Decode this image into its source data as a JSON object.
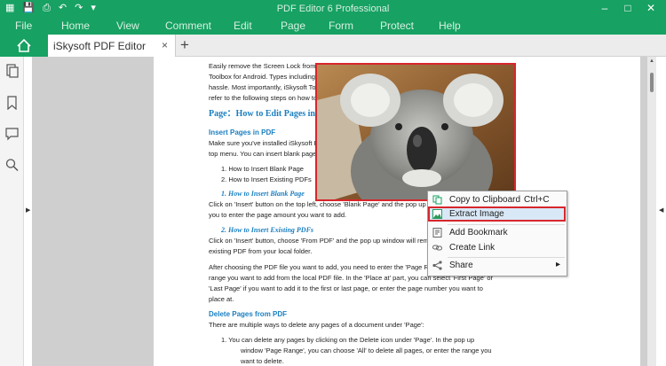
{
  "window": {
    "title": "PDF Editor 6 Professional"
  },
  "menu": [
    "File",
    "Home",
    "View",
    "Comment",
    "Edit",
    "Page",
    "Form",
    "Protect",
    "Help"
  ],
  "tab": {
    "name": "iSkysoft PDF Editor",
    "close": "×",
    "new": "+"
  },
  "page": {
    "l1": "Easily remove the Screen Lock from You",
    "l2": "Toolbox for Android. Types including Pl",
    "l3": "hassle. Most importantly, iSkysoft Tooll",
    "l4": "refer to the following steps on how to r",
    "h_edit": "Page：How to Edit Pages in P",
    "h_insert": "Insert Pages in PDF",
    "p_insert1": "Make sure you've installed iSkysoft PDF",
    "p_insert2": "top menu. You can insert blank pages o",
    "li1": "1.      How to Insert Blank Page",
    "li2": "2.      How to Insert Existing PDFs",
    "h_blank": "1.    How to Insert Blank Page",
    "p_blank1": "Click on 'Insert' button on the top left, choose 'Blank Page' and the pop up windo",
    "p_blank2": "you to enter the page amount you want to add.",
    "h_exist": "2.    How to Insert Existing PDFs",
    "p_exist1": "Click on 'Insert' button, choose 'From PDF' and the pop up window will remind y",
    "p_exist2": "existing PDF from your local folder.",
    "p_range1": "After choosing the PDF file you want to add, you need to enter the 'Page Range'",
    "p_range2": "range you want to add from the local PDF file. In the 'Place at' part, you can select 'First Page' or",
    "p_range3": "'Last Page' if you want to add it to the first or last page, or enter the page number you want to",
    "p_range4": "place at.",
    "h_delete": "Delete Pages from PDF",
    "p_delete": "There are multiple ways to delete any pages of a document under 'Page':",
    "d1a": "1.      You can delete any pages by clicking on the Delete icon under  'Page'. In the pop up",
    "d1b": "window 'Page Range', you can choose 'All' to delete all pages, or enter the range you",
    "d1c": "want to delete."
  },
  "context_menu": {
    "copy": "Copy to Clipboard",
    "copy_shortcut": "Ctrl+C",
    "extract": "Extract Image",
    "bookmark": "Add Bookmark",
    "link": "Create Link",
    "share": "Share",
    "share_arrow": "▸"
  },
  "colors": {
    "accent": "#17a162",
    "highlight": "#d7262c"
  }
}
